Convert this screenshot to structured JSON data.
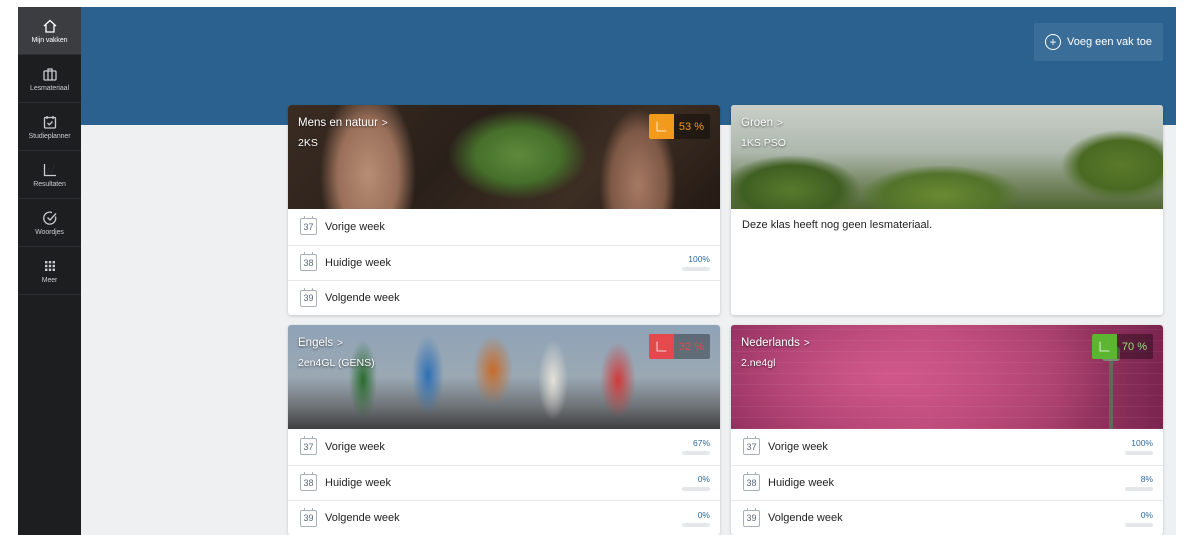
{
  "sidebar": {
    "items": [
      {
        "label": "Mijn vakken",
        "icon": "home-icon",
        "active": true
      },
      {
        "label": "Lesmateriaal",
        "icon": "briefcase-icon",
        "active": false
      },
      {
        "label": "Studieplanner",
        "icon": "calendar-check-icon",
        "active": false
      },
      {
        "label": "Resultaten",
        "icon": "chart-icon",
        "active": false
      },
      {
        "label": "Woordjes",
        "icon": "check-circle-icon",
        "active": false
      },
      {
        "label": "Meer",
        "icon": "grid-icon",
        "active": false
      }
    ]
  },
  "header": {
    "add_button_label": "Voeg een vak toe"
  },
  "cards": [
    {
      "title": "Mens en natuur",
      "chevron": ">",
      "class_name": "2KS",
      "score": "53 %",
      "score_color": "#f29a1c",
      "image": "plant-seedling-image",
      "weeks": [
        {
          "number": "37",
          "label": "Vorige week"
        },
        {
          "number": "38",
          "label": "Huidige week",
          "progress_text": "100%",
          "progress": 1.0
        },
        {
          "number": "39",
          "label": "Volgende week"
        }
      ]
    },
    {
      "title": "Groen",
      "chevron": ">",
      "class_name": "1KS PSO",
      "image": "topiary-garden-image",
      "empty_message": "Deze klas heeft nog geen lesmateriaal."
    },
    {
      "title": "Engels",
      "chevron": ">",
      "class_name": "2en4GL (GENS)",
      "score": "32 %",
      "score_color": "#e5484d",
      "image": "jumping-people-image",
      "weeks": [
        {
          "number": "37",
          "label": "Vorige week",
          "progress_text": "67%",
          "progress": 0.67
        },
        {
          "number": "38",
          "label": "Huidige week",
          "progress_text": "0%",
          "progress": 0
        },
        {
          "number": "39",
          "label": "Volgende week",
          "progress_text": "0%",
          "progress": 0
        }
      ]
    },
    {
      "title": "Nederlands",
      "chevron": ">",
      "class_name": "2.ne4gl",
      "score": "70 %",
      "score_color": "#5cb531",
      "image": "brick-wall-lamp-image",
      "weeks": [
        {
          "number": "37",
          "label": "Vorige week",
          "progress_text": "100%",
          "progress": 1.0
        },
        {
          "number": "38",
          "label": "Huidige week",
          "progress_text": "8%",
          "progress": 0.08
        },
        {
          "number": "39",
          "label": "Volgende week",
          "progress_text": "0%",
          "progress": 0
        }
      ]
    }
  ],
  "colors": {
    "banner": "#2a618f",
    "sidebar": "#1d1e20",
    "accent": "#2d6aa0"
  }
}
